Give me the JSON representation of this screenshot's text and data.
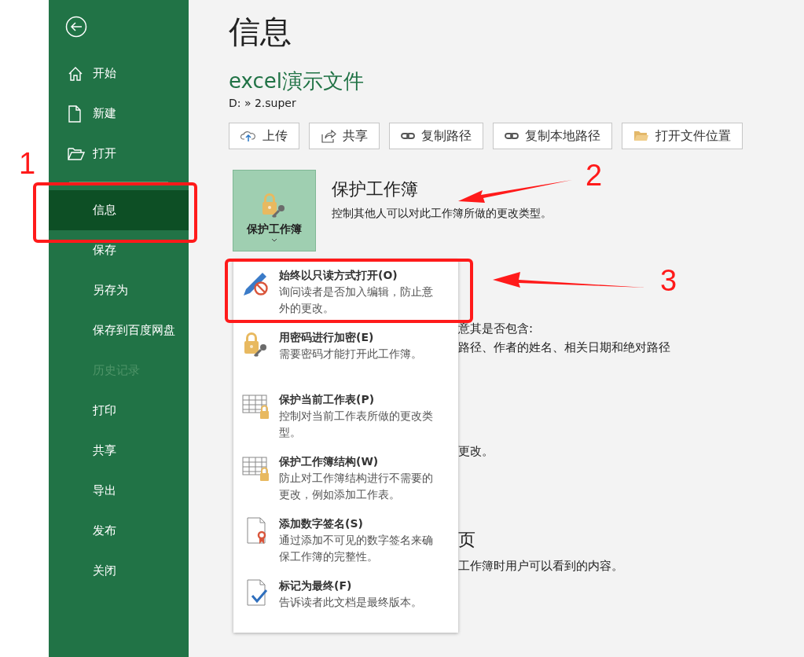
{
  "sidebar": {
    "items": [
      {
        "label": "开始",
        "selected": false,
        "disabled": false
      },
      {
        "label": "新建",
        "selected": false,
        "disabled": false
      },
      {
        "label": "打开",
        "selected": false,
        "disabled": false
      },
      {
        "label": "信息",
        "selected": true,
        "disabled": false
      },
      {
        "label": "保存",
        "selected": false,
        "disabled": false
      },
      {
        "label": "另存为",
        "selected": false,
        "disabled": false
      },
      {
        "label": "保存到百度网盘",
        "selected": false,
        "disabled": false
      },
      {
        "label": "历史记录",
        "selected": false,
        "disabled": true
      },
      {
        "label": "打印",
        "selected": false,
        "disabled": false
      },
      {
        "label": "共享",
        "selected": false,
        "disabled": false
      },
      {
        "label": "导出",
        "selected": false,
        "disabled": false
      },
      {
        "label": "发布",
        "selected": false,
        "disabled": false
      },
      {
        "label": "关闭",
        "selected": false,
        "disabled": false
      }
    ]
  },
  "main": {
    "title": "信息",
    "file_name": "excel演示文件",
    "path": "D: » 2.super",
    "actions": [
      {
        "label": "上传"
      },
      {
        "label": "共享"
      },
      {
        "label": "复制路径"
      },
      {
        "label": "复制本地路径"
      },
      {
        "label": "打开文件位置"
      }
    ],
    "protect": {
      "button_label": "保护工作簿",
      "heading": "保护工作簿",
      "description": "控制其他人可以对此工作簿所做的更改类型。"
    },
    "background_fragments": [
      {
        "kind": "text",
        "text": "意其是否包含:"
      },
      {
        "kind": "text",
        "text": "路径、作者的姓名、相关日期和绝对路径"
      },
      {
        "kind": "text",
        "text": "更改。"
      },
      {
        "kind": "heading",
        "text": "页"
      },
      {
        "kind": "text",
        "text": "工作簿时用户可以看到的内容。"
      }
    ],
    "menu": [
      {
        "title": "始终以只读方式打开(O)",
        "description": "询问读者是否加入编辑，防止意外的更改。"
      },
      {
        "title": "用密码进行加密(E)",
        "description": "需要密码才能打开此工作簿。"
      },
      {
        "title": "保护当前工作表(P)",
        "description": "控制对当前工作表所做的更改类型。"
      },
      {
        "title": "保护工作簿结构(W)",
        "description": "防止对工作簿结构进行不需要的更改，例如添加工作表。"
      },
      {
        "title": "添加数字签名(S)",
        "description": "通过添加不可见的数字签名来确保工作簿的完整性。"
      },
      {
        "title": "标记为最终(F)",
        "description": "告诉读者此文档是最终版本。"
      }
    ]
  },
  "annotations": [
    {
      "label": "1"
    },
    {
      "label": "2"
    },
    {
      "label": "3"
    }
  ]
}
